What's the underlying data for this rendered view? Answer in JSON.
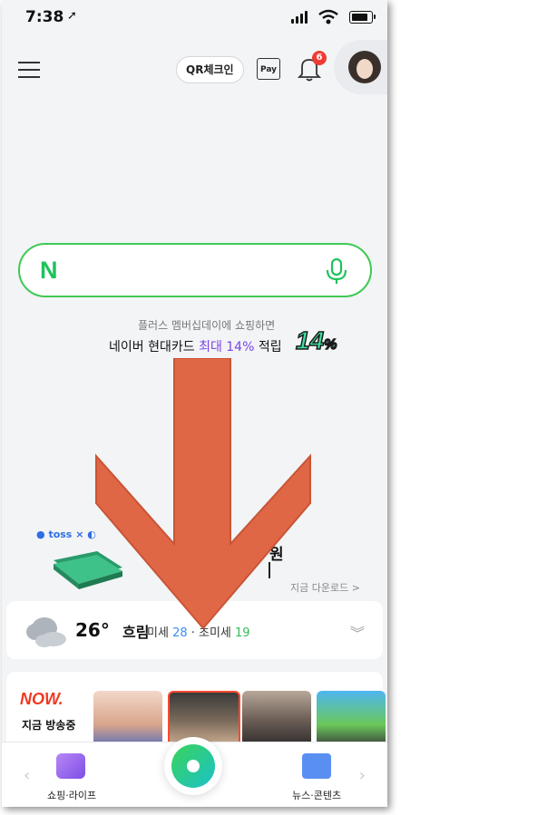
{
  "status": {
    "time": "7:38",
    "location_icon": "location-arrow-icon"
  },
  "header": {
    "qr_label": "QR체크인",
    "pay_label": "Pay",
    "notification_count": "6"
  },
  "search": {
    "logo": "N"
  },
  "promo": {
    "line1": "플러스 멤버십데이에 쇼핑하면",
    "line2_prefix": "네이버 현대카드 ",
    "line2_highlight": "최대 14%",
    "line2_suffix": " 적립",
    "badge_number": "14",
    "badge_percent": "%"
  },
  "toss_banner": {
    "brand": "toss",
    "amount_suffix": "원",
    "download": "지금 다운로드 >"
  },
  "weather": {
    "temp": "26°",
    "condition": "흐림",
    "fine_dust_label": "미세 ",
    "fine_dust_value": "28",
    "separator": " · ",
    "ultrafine_label": "초미세 ",
    "ultrafine_value": "19"
  },
  "now": {
    "logo": "NOW.",
    "label": "지금 방송중"
  },
  "bottom_nav": {
    "left_label": "쇼핑·라이프",
    "right_label": "뉴스·콘텐츠"
  },
  "colors": {
    "naver_green": "#1ec35c",
    "arrow": "#e0623f",
    "promo_purple": "#7b43e8",
    "now_red": "#f03a23"
  }
}
